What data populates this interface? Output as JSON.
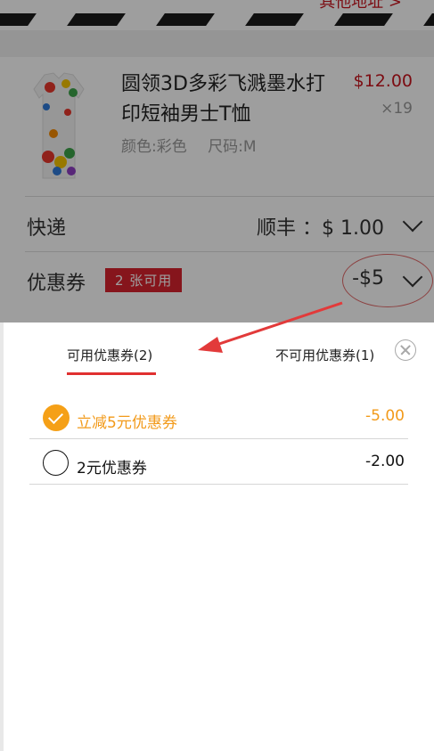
{
  "header": {
    "address_link": "其他地址 >"
  },
  "product": {
    "title": "圆领3D多彩飞溅墨水打印短袖男士T恤",
    "color": "颜色:彩色",
    "size": "尺码:M",
    "price": "$12.00",
    "quantity": "×19"
  },
  "shipping": {
    "label": "快递",
    "value": "顺丰 ：$ 1.00"
  },
  "coupon_row": {
    "label": "优惠券",
    "badge": "2 张可用",
    "value": "-$5"
  },
  "coupon_sheet": {
    "tabs": [
      {
        "label": "可用优惠券(2)",
        "active": true
      },
      {
        "label": "不可用优惠券(1)",
        "active": false
      }
    ],
    "coupons": [
      {
        "name": "立减5元优惠券",
        "amount": "-5.00",
        "selected": true
      },
      {
        "name": "2元优惠券",
        "amount": "-2.00",
        "selected": false
      }
    ]
  },
  "colors": {
    "accent_red": "#c8141e",
    "selected_orange": "#f29a1a",
    "badge_red": "#d9232e"
  },
  "icons": {
    "close": "close-circle-icon",
    "check": "check-circle-icon",
    "chevron": "chevron-down-icon"
  }
}
